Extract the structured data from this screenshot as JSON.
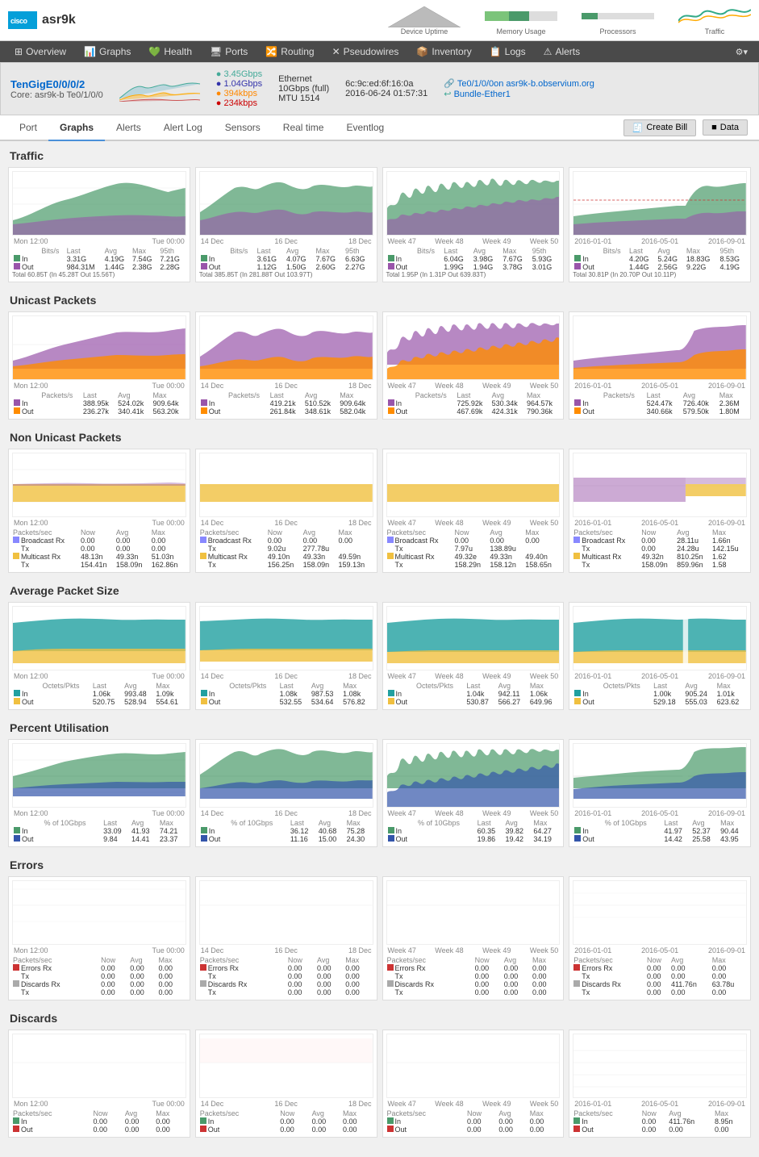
{
  "header": {
    "cisco_label": "cisco",
    "device_name": "asr9k",
    "top_stats": [
      {
        "label": "Device Uptime",
        "color": "#888"
      },
      {
        "label": "Memory Usage",
        "color": "#4a9"
      },
      {
        "label": "Processors",
        "color": "#4a9"
      },
      {
        "label": "Traffic",
        "color": "#4a9"
      }
    ]
  },
  "nav": {
    "items": [
      {
        "label": "Overview",
        "icon": "⊞",
        "active": false
      },
      {
        "label": "Graphs",
        "icon": "📈",
        "active": false
      },
      {
        "label": "Health",
        "icon": "💚",
        "active": false
      },
      {
        "label": "Ports",
        "icon": "🖥",
        "active": false
      },
      {
        "label": "Routing",
        "icon": "⛺",
        "active": false
      },
      {
        "label": "Pseudowires",
        "icon": "✕",
        "active": false
      },
      {
        "label": "Inventory",
        "icon": "📦",
        "active": false
      },
      {
        "label": "Logs",
        "icon": "📋",
        "active": false
      },
      {
        "label": "Alerts",
        "icon": "⚠",
        "active": false
      }
    ]
  },
  "interface": {
    "name": "TenGigE0/0/0/2",
    "core": "Core: asr9k-b Te0/1/0/0",
    "speeds": {
      "s1": "3.45Gbps",
      "s2": "1.04Gbps",
      "s3": "394kbps",
      "s4": "234kbps"
    },
    "eth_type": "Ethernet",
    "eth_speed": "10Gbps (full)",
    "mac": "6c:9c:ed:6f:16:0a",
    "mtu": "MTU 1514",
    "date": "2016-06-24 01:57:31",
    "link1": "Te0/1/0/0on asr9k-b.observium.org",
    "link2": "Bundle-Ether1"
  },
  "tabs": {
    "items": [
      "Port",
      "Graphs",
      "Alerts",
      "Alert Log",
      "Sensors",
      "Real time",
      "Eventlog"
    ],
    "active": "Graphs"
  },
  "tab_actions": {
    "create_bill": "Create Bill",
    "data": "Data"
  },
  "sections": {
    "traffic": {
      "title": "Traffic",
      "charts": [
        {
          "x_labels": [
            "Mon 12:00",
            "Tue 00:00"
          ],
          "stat_headers": [
            "Bits/s",
            "Last",
            "Avg",
            "Max",
            "95th"
          ],
          "in_vals": [
            "3.31G",
            "4.19G",
            "7.54G",
            "7.21G"
          ],
          "out_vals": [
            "984.31M",
            "1.44G",
            "2.38G",
            "2.28G"
          ],
          "total": "Total 60.85T (In 45.28T Out 15.56T)"
        },
        {
          "x_labels": [
            "14 Dec",
            "16 Dec",
            "18 Dec"
          ],
          "in_vals": [
            "3.61G",
            "4.07G",
            "7.67G",
            "6.63G"
          ],
          "out_vals": [
            "1.12G",
            "1.50G",
            "2.60G",
            "2.27G"
          ],
          "total": "Total 385.85T (In 281.88T Out 103.97T)"
        },
        {
          "x_labels": [
            "Week 47",
            "Week 48",
            "Week 49",
            "Week 50"
          ],
          "in_vals": [
            "6.04G",
            "3.98G",
            "7.67G",
            "5.93G"
          ],
          "out_vals": [
            "1.99G",
            "1.94G",
            "3.78G",
            "3.01G"
          ],
          "total": "Total 1.95P (In 1.31P Out 639.83T)"
        },
        {
          "x_labels": [
            "2016-01-01",
            "2016-05-01",
            "2016-09-01"
          ],
          "in_vals": [
            "4.20G",
            "5.24G",
            "18.83G",
            "8.53G"
          ],
          "out_vals": [
            "1.44G",
            "2.56G",
            "9.22G",
            "4.19G"
          ],
          "total": "Total 30.81P (In 20.70P Out 10.11P)"
        }
      ]
    },
    "unicast": {
      "title": "Unicast Packets",
      "charts": [
        {
          "x_labels": [
            "Mon 12:00",
            "Tue 00:00"
          ],
          "in_vals": [
            "388.95k",
            "524.02k",
            "909.64k"
          ],
          "out_vals": [
            "236.27k",
            "340.41k",
            "563.20k"
          ]
        },
        {
          "x_labels": [
            "14 Dec",
            "16 Dec",
            "18 Dec"
          ],
          "in_vals": [
            "419.21k",
            "510.52k",
            "909.64k"
          ],
          "out_vals": [
            "261.84k",
            "348.61k",
            "582.04k"
          ]
        },
        {
          "x_labels": [
            "Week 47",
            "Week 48",
            "Week 49",
            "Week 50"
          ],
          "in_vals": [
            "725.92k",
            "530.34k",
            "964.57k"
          ],
          "out_vals": [
            "467.69k",
            "424.31k",
            "790.36k"
          ]
        },
        {
          "x_labels": [
            "2016-01-01",
            "2016-05-01",
            "2016-09-01"
          ],
          "in_vals": [
            "524.47k",
            "726.40k",
            "2.36M"
          ],
          "out_vals": [
            "340.66k",
            "579.50k",
            "1.80M"
          ]
        }
      ]
    },
    "nonunicast": {
      "title": "Non Unicast Packets",
      "charts": [
        {
          "x_labels": [
            "Mon 12:00",
            "Tue 00:00"
          ],
          "rows": [
            {
              "label": "Broadcast Rx",
              "now": "0.00",
              "avg": "0.00",
              "max": "0.00"
            },
            {
              "label": "Tx",
              "now": "0.00",
              "avg": "0.00",
              "max": "0.00"
            },
            {
              "label": "Multicast Rx",
              "now": "48.13n",
              "avg": "49.33n",
              "max": "51.03n"
            },
            {
              "label": "Tx",
              "now": "154.41n",
              "avg": "158.09n",
              "max": "162.86n"
            }
          ]
        },
        {
          "x_labels": [
            "14 Dec",
            "16 Dec",
            "18 Dec"
          ],
          "rows": [
            {
              "label": "Broadcast Rx",
              "now": "0.00",
              "avg": "0.00",
              "max": "0.00"
            },
            {
              "label": "Tx",
              "now": "9.02u",
              "avg": "277.78u"
            },
            {
              "label": "Multicast Rx",
              "now": "49.10n",
              "avg": "49.33n",
              "max": "49.59n"
            },
            {
              "label": "Tx",
              "now": "156.25n",
              "avg": "158.09n",
              "max": "159.13n"
            }
          ]
        },
        {
          "x_labels": [
            "Week 47",
            "Week 48",
            "Week 49",
            "Week 50"
          ],
          "rows": [
            {
              "label": "Broadcast Rx",
              "now": "0.00",
              "avg": "0.00",
              "max": "0.00"
            },
            {
              "label": "Tx",
              "now": "7.97u",
              "avg": "138.89u"
            },
            {
              "label": "Multicast Rx",
              "now": "49.32e",
              "avg": "49.33n",
              "max": "49.40n"
            },
            {
              "label": "Tx",
              "now": "158.29n",
              "avg": "158.12n",
              "max": "158.65n"
            }
          ]
        },
        {
          "x_labels": [
            "2016-01-01",
            "2016-05-01",
            "2016-09-01"
          ],
          "rows": [
            {
              "label": "Broadcast Rx",
              "now": "0.00",
              "avg": "28.11u",
              "max": "1.66n"
            },
            {
              "label": "Tx",
              "now": "0.00",
              "avg": "24.28u",
              "max": "142.15u"
            },
            {
              "label": "Multicast Rx",
              "now": "49.32n",
              "avg": "810.25n",
              "max": "1.62"
            },
            {
              "label": "Tx",
              "now": "158.09n",
              "avg": "859.96n",
              "max": "1.58"
            }
          ]
        }
      ]
    },
    "avg_packet": {
      "title": "Average Packet Size",
      "charts": [
        {
          "x_labels": [
            "Mon 12:00",
            "Tue 00:00"
          ],
          "in_vals": [
            "1.06k",
            "993.48",
            "1.09k"
          ],
          "out_vals": [
            "520.75",
            "528.94",
            "554.61"
          ]
        },
        {
          "x_labels": [
            "14 Dec",
            "16 Dec",
            "18 Dec"
          ],
          "in_vals": [
            "1.08k",
            "987.53",
            "1.08k"
          ],
          "out_vals": [
            "532.55",
            "534.64",
            "576.82"
          ]
        },
        {
          "x_labels": [
            "Week 47",
            "Week 48",
            "Week 49",
            "Week 50"
          ],
          "in_vals": [
            "1.04k",
            "942.11",
            "1.06k"
          ],
          "out_vals": [
            "530.87",
            "566.27",
            "649.96"
          ]
        },
        {
          "x_labels": [
            "2016-01-01",
            "2016-05-01",
            "2016-09-01"
          ],
          "in_vals": [
            "1.00k",
            "905.24",
            "1.01k"
          ],
          "out_vals": [
            "529.18",
            "555.03",
            "623.62"
          ]
        }
      ]
    },
    "utilisation": {
      "title": "Percent Utilisation",
      "charts": [
        {
          "x_labels": [
            "Mon 12:00",
            "Tue 00:00"
          ],
          "in_vals": [
            "33.09",
            "41.93",
            "74.21"
          ],
          "out_vals": [
            "9.84",
            "14.41",
            "23.37"
          ]
        },
        {
          "x_labels": [
            "14 Dec",
            "16 Dec",
            "18 Dec"
          ],
          "in_vals": [
            "36.12",
            "40.68",
            "75.28"
          ],
          "out_vals": [
            "11.16",
            "15.00",
            "24.30"
          ]
        },
        {
          "x_labels": [
            "Week 47",
            "Week 48",
            "Week 49",
            "Week 50"
          ],
          "in_vals": [
            "60.35",
            "39.82",
            "64.27"
          ],
          "out_vals": [
            "19.86",
            "19.42",
            "34.19"
          ]
        },
        {
          "x_labels": [
            "2016-01-01",
            "2016-05-01",
            "2016-09-01"
          ],
          "in_vals": [
            "41.97",
            "52.37",
            "90.44"
          ],
          "out_vals": [
            "14.42",
            "25.58",
            "43.95"
          ]
        }
      ]
    },
    "errors": {
      "title": "Errors",
      "charts": [
        {
          "x_labels": [
            "Mon 12:00",
            "Tue 00:00"
          ],
          "rows": [
            {
              "label": "Errors Rx",
              "now": "0.00",
              "avg": "0.00",
              "max": "0.00"
            },
            {
              "label": "Tx",
              "now": "0.00",
              "avg": "0.00",
              "max": "0.00"
            },
            {
              "label": "Discards Rx",
              "now": "0.00",
              "avg": "0.00",
              "max": "0.00"
            },
            {
              "label": "Tx",
              "now": "0.00",
              "avg": "0.00",
              "max": "0.00"
            }
          ]
        },
        {
          "x_labels": [
            "14 Dec",
            "16 Dec",
            "18 Dec"
          ],
          "rows": [
            {
              "label": "Errors Rx",
              "now": "0.00",
              "avg": "0.00",
              "max": "0.00"
            },
            {
              "label": "Tx",
              "now": "0.00",
              "avg": "0.00",
              "max": "0.00"
            },
            {
              "label": "Discards Rx",
              "now": "0.00",
              "avg": "0.00",
              "max": "0.00"
            },
            {
              "label": "Tx",
              "now": "0.00",
              "avg": "0.00",
              "max": "0.00"
            }
          ]
        },
        {
          "x_labels": [
            "Week 47",
            "Week 48",
            "Week 49",
            "Week 50"
          ],
          "rows": [
            {
              "label": "Errors Rx",
              "now": "0.00",
              "avg": "0.00",
              "max": "0.00"
            },
            {
              "label": "Tx",
              "now": "0.00",
              "avg": "0.00",
              "max": "0.00"
            },
            {
              "label": "Discards Rx",
              "now": "0.00",
              "avg": "0.00",
              "max": "0.00"
            },
            {
              "label": "Tx",
              "now": "0.00",
              "avg": "0.00",
              "max": "0.00"
            }
          ]
        },
        {
          "x_labels": [
            "2016-01-01",
            "2016-05-01",
            "2016-09-01"
          ],
          "rows": [
            {
              "label": "Errors Rx",
              "now": "0.00",
              "avg": "0.00",
              "max": "0.00"
            },
            {
              "label": "Tx",
              "now": "0.00",
              "avg": "0.00",
              "max": "0.00"
            },
            {
              "label": "Discards Rx",
              "now": "0.00",
              "avg": "411.76n",
              "max": "63.78u"
            },
            {
              "label": "Tx",
              "now": "0.00",
              "avg": "0.00",
              "max": "0.00"
            }
          ]
        }
      ]
    },
    "discards": {
      "title": "Discards",
      "charts": [
        {
          "x_labels": [
            "Mon 12:00",
            "Tue 00:00"
          ],
          "rows": [
            {
              "label": "In",
              "now": "0.00",
              "avg": "0.00",
              "max": "0.00"
            },
            {
              "label": "Out",
              "now": "0.00",
              "avg": "0.00",
              "max": "0.00"
            }
          ]
        },
        {
          "x_labels": [
            "14 Dec",
            "16 Dec",
            "18 Dec"
          ],
          "rows": [
            {
              "label": "In",
              "now": "0.00",
              "avg": "0.00",
              "max": "0.00"
            },
            {
              "label": "Out",
              "now": "0.00",
              "avg": "0.00",
              "max": "0.00"
            }
          ]
        },
        {
          "x_labels": [
            "Week 47",
            "Week 48",
            "Week 49",
            "Week 50"
          ],
          "rows": [
            {
              "label": "In",
              "now": "0.00",
              "avg": "0.00",
              "max": "0.00"
            },
            {
              "label": "Out",
              "now": "0.00",
              "avg": "0.00",
              "max": "0.00"
            }
          ]
        },
        {
          "x_labels": [
            "2016-01-01",
            "2016-05-01",
            "2016-09-01"
          ],
          "rows": [
            {
              "label": "In",
              "now": "0.00",
              "avg": "411.76n",
              "max": "8.95n"
            },
            {
              "label": "Out",
              "now": "0.00",
              "avg": "0.00",
              "max": "0.00"
            }
          ]
        }
      ]
    }
  }
}
